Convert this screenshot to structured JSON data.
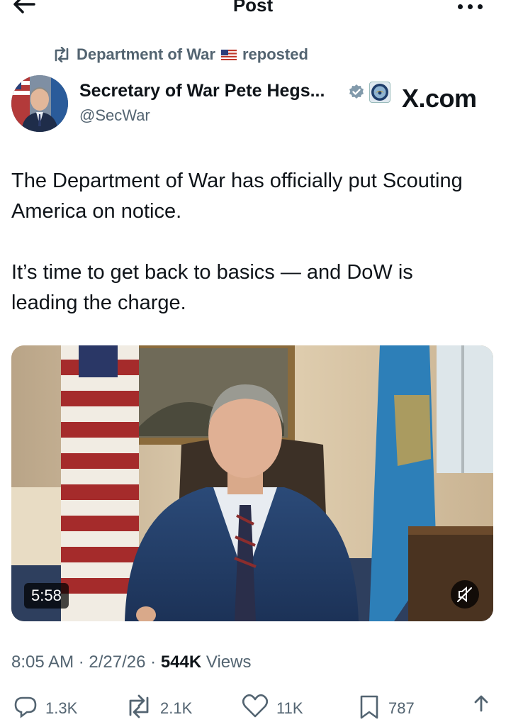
{
  "header": {
    "title": "Post",
    "back_icon": "back-arrow-icon",
    "more_icon": "more-icon"
  },
  "repost": {
    "text": "Department of War",
    "flag": "🇺🇸",
    "suffix": "reposted"
  },
  "author": {
    "name": "Secretary of War Pete Hegs...",
    "handle": "@SecWar",
    "verified_color": "#829aab",
    "affiliation": "X.com"
  },
  "tweet": {
    "paragraph1": "The Department of War has officially put Scouting America on notice.",
    "paragraph2": "It’s time to get back to basics — and DoW is leading the charge."
  },
  "media": {
    "duration": "5:58",
    "muted": true
  },
  "meta": {
    "time": "8:05 AM",
    "date": "2/27/26",
    "views_count": "544K",
    "views_label": "Views"
  },
  "actions": {
    "replies": "1.3K",
    "reposts": "2.1K",
    "likes": "11K",
    "bookmarks": "787"
  }
}
